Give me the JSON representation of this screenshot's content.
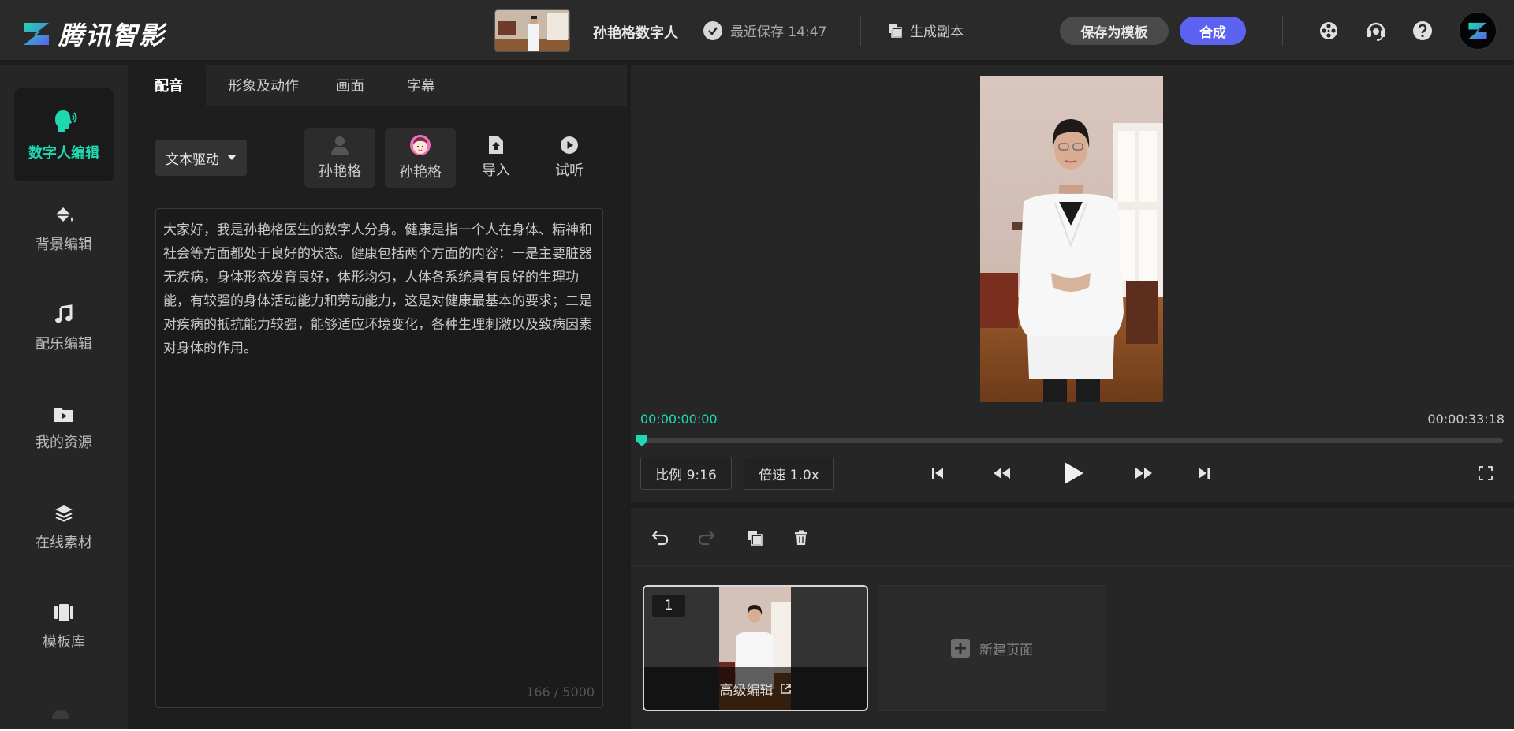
{
  "app": {
    "brand": "腾讯智影",
    "project_name": "孙艳格数字人",
    "save_status": "最近保存 14:47",
    "make_copy": "生成副本",
    "save_template": "保存为模板",
    "compose": "合成",
    "colors": {
      "accent": "#1ed9b0",
      "primary": "#5b63f0",
      "bg": "#1d1d1d",
      "panel": "#262626"
    }
  },
  "top_icons": [
    "film-reel-icon",
    "customer-service-icon",
    "help-icon"
  ],
  "sidebar": {
    "items": [
      {
        "label": "数字人编辑",
        "icon": "speaking-head-icon",
        "active": true
      },
      {
        "label": "背景编辑",
        "icon": "paint-bucket-icon"
      },
      {
        "label": "配乐编辑",
        "icon": "music-note-icon"
      },
      {
        "label": "我的资源",
        "icon": "folder-play-icon"
      },
      {
        "label": "在线素材",
        "icon": "layers-icon"
      },
      {
        "label": "模板库",
        "icon": "template-icon"
      }
    ]
  },
  "editor": {
    "tabs": [
      "配音",
      "形象及动作",
      "画面",
      "字幕"
    ],
    "mode_dropdown": "文本驱动",
    "tools": [
      {
        "label": "孙艳格",
        "icon": "person-silhouette-icon"
      },
      {
        "label": "孙艳格",
        "icon": "avatar-face-icon"
      },
      {
        "label": "导入",
        "icon": "import-file-icon"
      },
      {
        "label": "试听",
        "icon": "play-circle-icon"
      }
    ],
    "script_text": "大家好，我是孙艳格医生的数字人分身。健康是指一个人在身体、精神和社会等方面都处于良好的状态。健康包括两个方面的内容：一是主要脏器无疾病，身体形态发育良好，体形均匀，人体各系统具有良好的生理功能，有较强的身体活动能力和劳动能力，这是对健康最基本的要求；二是对疾病的抵抗能力较强，能够适应环境变化，各种生理刺激以及致病因素对身体的作用。",
    "char_count": "166 / 5000"
  },
  "player": {
    "time_current": "00:00:00:00",
    "time_total": "00:00:33:18",
    "progress": 0,
    "ratio": "比例 9:16",
    "speed": "倍速 1.0x"
  },
  "timeline": {
    "page_number": "1",
    "advanced_edit": "高级编辑",
    "new_page": "新建页面"
  }
}
